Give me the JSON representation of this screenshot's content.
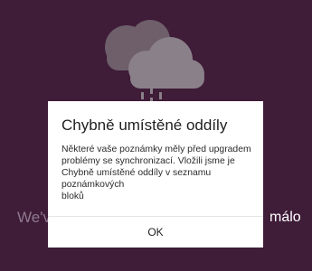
{
  "background": {
    "partial_text_left": "We'v",
    "partial_text_right": "málo"
  },
  "dialog": {
    "title": "Chybně umístěné oddíly",
    "message": "Některé vaše poznámky měly před upgradem\nproblémy se synchronizací. Vložili jsme je\nChybně umístěné oddíly v seznamu poznámkových\nbloků",
    "ok_label": "OK"
  },
  "icons": {
    "illustration": "cloud-sync-icon"
  },
  "colors": {
    "backdrop": "#3f1c38",
    "dialog_bg": "#ffffff",
    "cloud": "#8a8089"
  }
}
